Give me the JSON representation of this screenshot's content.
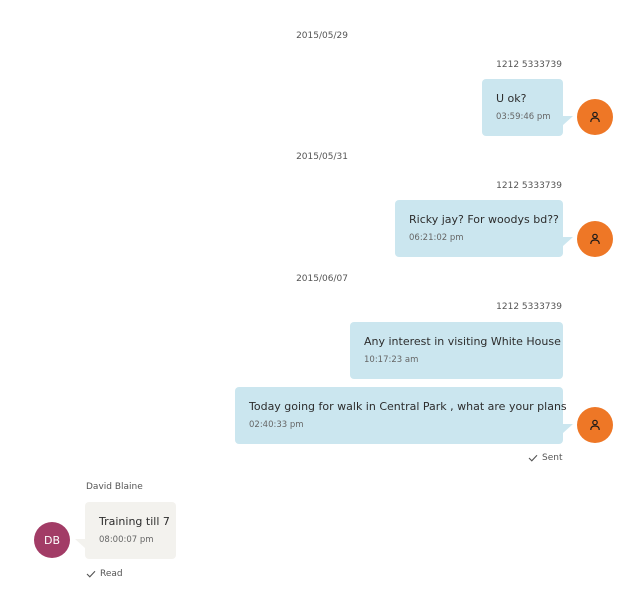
{
  "conversation": [
    {
      "date": "2015/05/29",
      "sender": "1212 5333739",
      "messages": [
        {
          "text": "U ok?",
          "time": "03:59:46 pm"
        }
      ]
    },
    {
      "date": "2015/05/31",
      "sender": "1212 5333739",
      "messages": [
        {
          "text": "Ricky jay? For woodys bd??",
          "time": "06:21:02 pm"
        }
      ]
    },
    {
      "date": "2015/06/07",
      "sender": "1212 5333739",
      "messages": [
        {
          "text": "Any interest in visiting White House",
          "time": "10:17:23 am"
        },
        {
          "text": "Today going for walk in Central Park , what are your plans",
          "time": "02:40:33 pm"
        }
      ],
      "status": "Sent"
    }
  ],
  "incoming": {
    "sender": "David Blaine",
    "initials": "DB",
    "text": "Training till 7",
    "time": "08:00:07 pm",
    "status": "Read"
  },
  "icons": {
    "user_avatar": "person-icon",
    "status": "check-icon"
  },
  "colors": {
    "outgoing_bubble": "#cbe6ef",
    "incoming_bubble": "#f3f2ee",
    "user_avatar": "#ee7726",
    "db_avatar": "#a23c66"
  }
}
